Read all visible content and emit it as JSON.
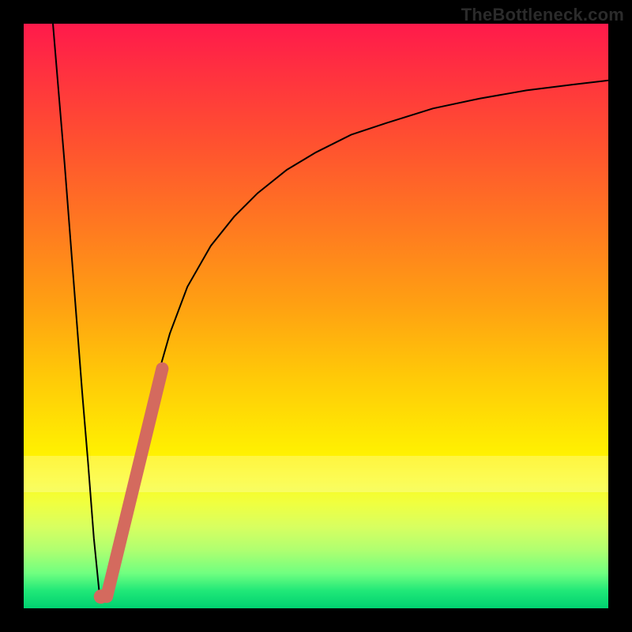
{
  "meta": {
    "watermark": "TheBottleneck.com"
  },
  "chart_data": {
    "type": "line",
    "title": "",
    "xlabel": "",
    "ylabel": "",
    "xlim": [
      0,
      100
    ],
    "ylim": [
      0,
      100
    ],
    "grid": false,
    "legend": false,
    "pale_band_y": [
      20,
      26
    ],
    "series": [
      {
        "name": "left-branch",
        "color": "#000000",
        "stroke_width": 2,
        "x": [
          5,
          6,
          7,
          8,
          9,
          10,
          11,
          12,
          13
        ],
        "y": [
          100,
          88,
          76,
          63,
          50,
          37,
          25,
          12,
          2
        ]
      },
      {
        "name": "right-curve",
        "color": "#000000",
        "stroke_width": 2,
        "x": [
          13,
          14,
          15,
          17,
          19,
          21,
          23,
          25,
          28,
          32,
          36,
          40,
          45,
          50,
          56,
          62,
          70,
          78,
          86,
          94,
          100
        ],
        "y": [
          2,
          3,
          6,
          14,
          23,
          32,
          40,
          47,
          55,
          62,
          67,
          71,
          75,
          78,
          81,
          83,
          85.5,
          87.2,
          88.6,
          89.6,
          90.3
        ]
      },
      {
        "name": "highlight-segment",
        "color": "#d46a5e",
        "stroke_width": 12,
        "linecap": "round",
        "x": [
          14.2,
          23.7
        ],
        "y": [
          2.0,
          41.0
        ]
      },
      {
        "name": "highlight-dot",
        "color": "#d46a5e",
        "type_hint": "marker",
        "x": [
          13.2
        ],
        "y": [
          2.0
        ],
        "r": 7
      }
    ]
  }
}
